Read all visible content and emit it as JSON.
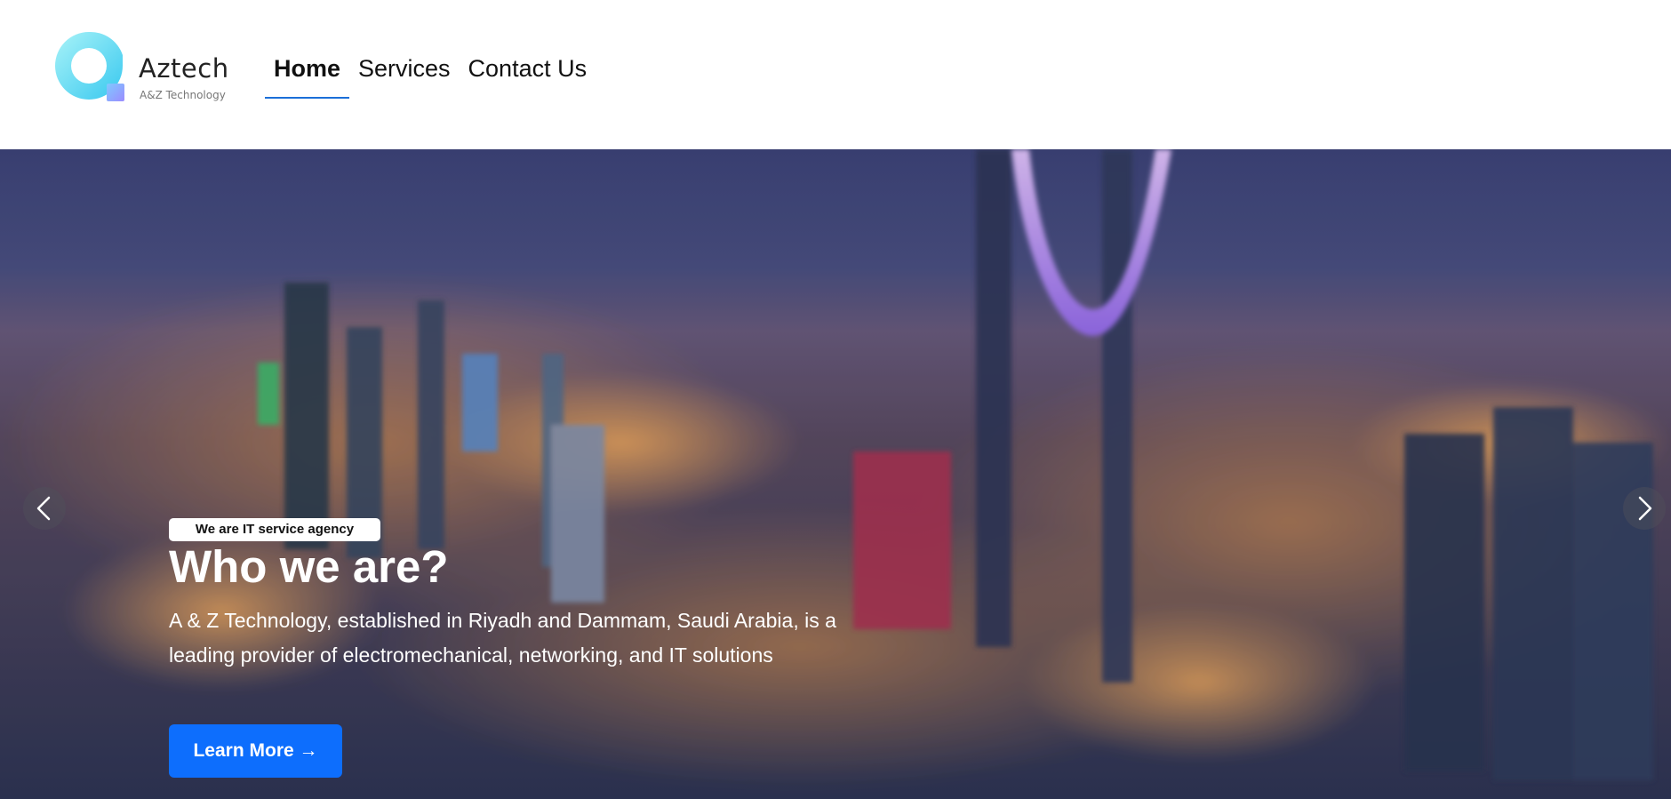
{
  "brand": {
    "name": "Aztech",
    "tagline": "A&Z Technology"
  },
  "nav": {
    "items": [
      {
        "label": "Home",
        "active": true
      },
      {
        "label": "Services",
        "active": false
      },
      {
        "label": "Contact Us",
        "active": false
      }
    ]
  },
  "hero": {
    "badge": "We are IT service agency",
    "title": "Who we are?",
    "description": "A & Z Technology, established in Riyadh and Dammam, Saudi Arabia, is a leading provider of electromechanical, networking, and IT solutions",
    "cta_label": "Learn More →",
    "prev_icon": "chevron-left-icon",
    "next_icon": "chevron-right-icon"
  },
  "colors": {
    "accent": "#0d6efd",
    "nav_underline": "#1b6fd8",
    "logo_gradient_start": "#7fe8f2",
    "logo_gradient_end": "#4fb6f0"
  }
}
